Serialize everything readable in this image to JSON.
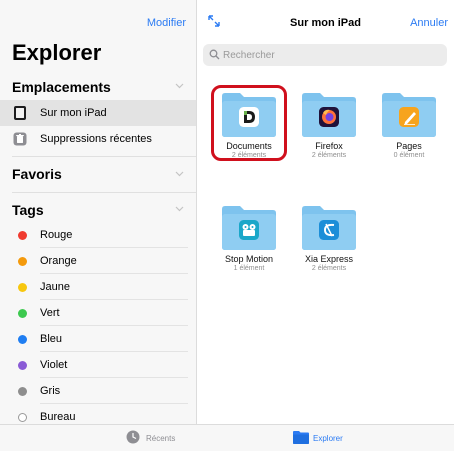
{
  "sidebar": {
    "edit_label": "Modifier",
    "title": "Explorer",
    "locations": {
      "heading": "Emplacements",
      "items": [
        {
          "label": "Sur mon iPad",
          "icon": "ipad-icon",
          "selected": true
        },
        {
          "label": "Suppressions récentes",
          "icon": "trash-icon",
          "selected": false
        }
      ]
    },
    "favorites": {
      "heading": "Favoris"
    },
    "tags": {
      "heading": "Tags",
      "items": [
        {
          "label": "Rouge",
          "color": "#f03b30"
        },
        {
          "label": "Orange",
          "color": "#f49a0c"
        },
        {
          "label": "Jaune",
          "color": "#f7c70f"
        },
        {
          "label": "Vert",
          "color": "#3dc94f"
        },
        {
          "label": "Bleu",
          "color": "#1f7ef2"
        },
        {
          "label": "Violet",
          "color": "#8a5bd6"
        },
        {
          "label": "Gris",
          "color": "#8e8e8e"
        },
        {
          "label": "Bureau",
          "color": ""
        }
      ]
    }
  },
  "main": {
    "title": "Sur mon iPad",
    "cancel_label": "Annuler",
    "search": {
      "placeholder": "Rechercher",
      "value": ""
    },
    "folders": [
      {
        "name": "Documents",
        "count": "2 éléments",
        "app_icon": "documents-app-icon",
        "highlighted": true
      },
      {
        "name": "Firefox",
        "count": "2 éléments",
        "app_icon": "firefox-app-icon",
        "highlighted": false
      },
      {
        "name": "Pages",
        "count": "0 élément",
        "app_icon": "pages-app-icon",
        "highlighted": false
      },
      {
        "name": "Stop Motion",
        "count": "1 élément",
        "app_icon": "stop-motion-app-icon",
        "highlighted": false
      },
      {
        "name": "Xia Express",
        "count": "2 éléments",
        "app_icon": "xia-express-app-icon",
        "highlighted": false
      }
    ]
  },
  "tabbar": {
    "tabs": [
      {
        "label": "Récents",
        "icon": "clock-icon",
        "active": false
      },
      {
        "label": "Explorer",
        "icon": "folder-icon",
        "active": true
      }
    ]
  },
  "colors": {
    "accent": "#2b7bf3",
    "folder": "#7ec3ee",
    "highlight_border": "#d0101d"
  }
}
